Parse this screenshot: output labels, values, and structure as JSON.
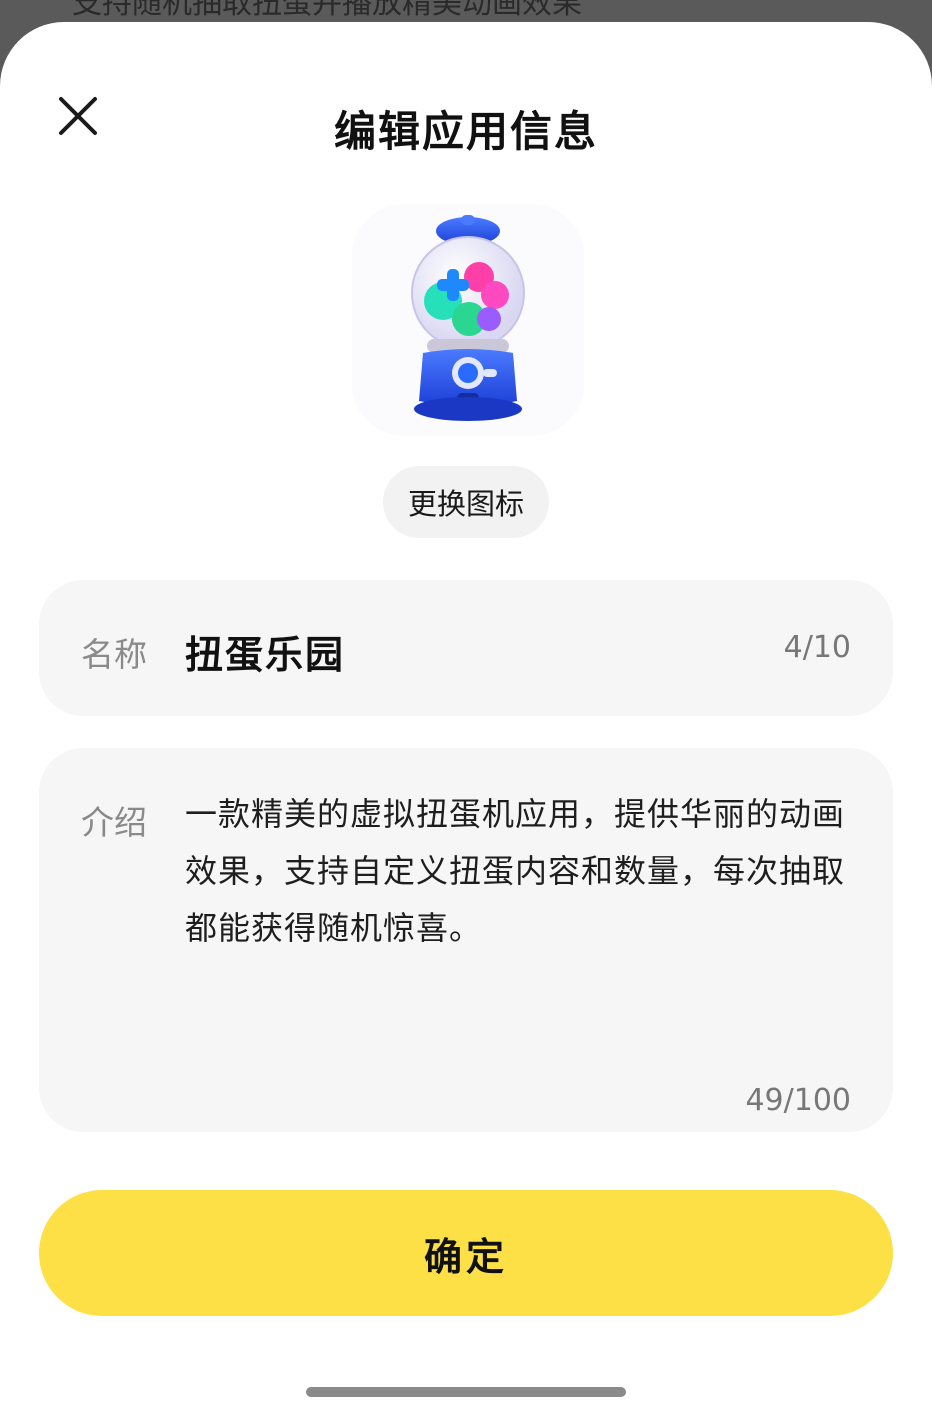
{
  "backdrop": {
    "text": "支持随机抽取扭蛋并播放精美动画效果"
  },
  "sheet": {
    "title": "编辑应用信息",
    "change_icon_label": "更换图标",
    "app_icon": "gumball-machine-icon"
  },
  "name_field": {
    "label": "名称",
    "value": "扭蛋乐园",
    "count": "4/10"
  },
  "intro_field": {
    "label": "介绍",
    "value": "一款精美的虚拟扭蛋机应用，提供华丽的动画效果，支持自定义扭蛋内容和数量，每次抽取都能获得随机惊喜。",
    "count": "49/100"
  },
  "confirm_label": "确定",
  "colors": {
    "accent": "#fde046",
    "field_bg": "#f6f6f6",
    "pill_bg": "#f2f2f2"
  }
}
